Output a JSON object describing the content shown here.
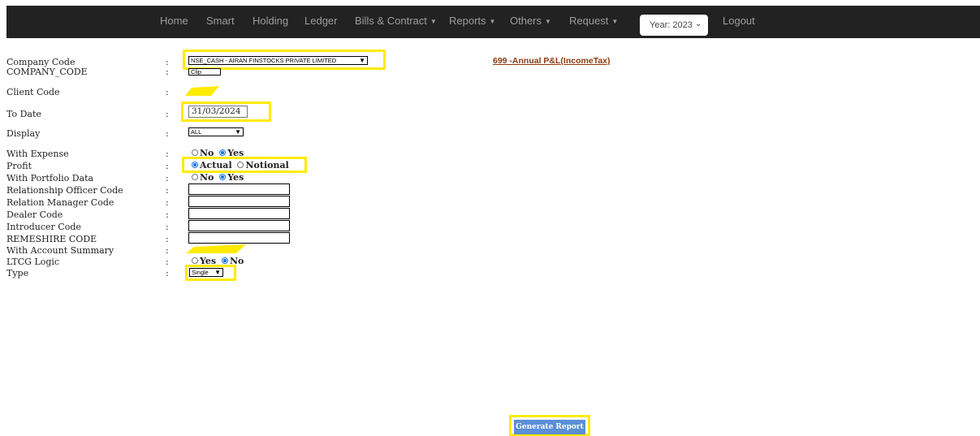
{
  "nav": {
    "items": [
      "Home",
      "Smart",
      "Holding",
      "Ledger",
      "Bills & Contract",
      "Reports",
      "Others",
      "Request"
    ],
    "year_select": "Year: 2023",
    "logout": "Logout"
  },
  "form": {
    "company_code_label": "Company Code",
    "company_code_sub_label": "COMPANY_CODE",
    "company_code_value": "NSE_CASH - AIRAN FINSTOCKS PRIVATE LIMITED",
    "company_code_sub_value": "Clip",
    "client_code_label": "Client Code",
    "to_date_label": "To Date",
    "to_date_value": "31/03/2024",
    "display_label": "Display",
    "display_value": "ALL",
    "with_expense_label": "With Expense",
    "profit_label": "Profit",
    "with_portfolio_label": "With Portfolio Data",
    "ro_code_label": "Relationship Officer Code",
    "rm_code_label": "Relation Manager Code",
    "dealer_code_label": "Dealer Code",
    "introducer_code_label": "Introducer Code",
    "remeshire_code_label": "REMESHIRE CODE",
    "with_account_summary_label": "With Account Summary",
    "ltcg_logic_label": "LTCG Logic",
    "type_label": "Type",
    "type_value": "Single",
    "colon": ":",
    "opt_no": "No",
    "opt_yes": "Yes",
    "opt_actual": "Actual",
    "opt_notional": "Notional"
  },
  "report_link": "699 -Annual P&L(IncomeTax)",
  "generate_button": "Generate Report",
  "colors": {
    "highlight": "#ffea00",
    "navbar": "#222222",
    "button": "#5b8fd6",
    "link": "#8b3a0f"
  }
}
